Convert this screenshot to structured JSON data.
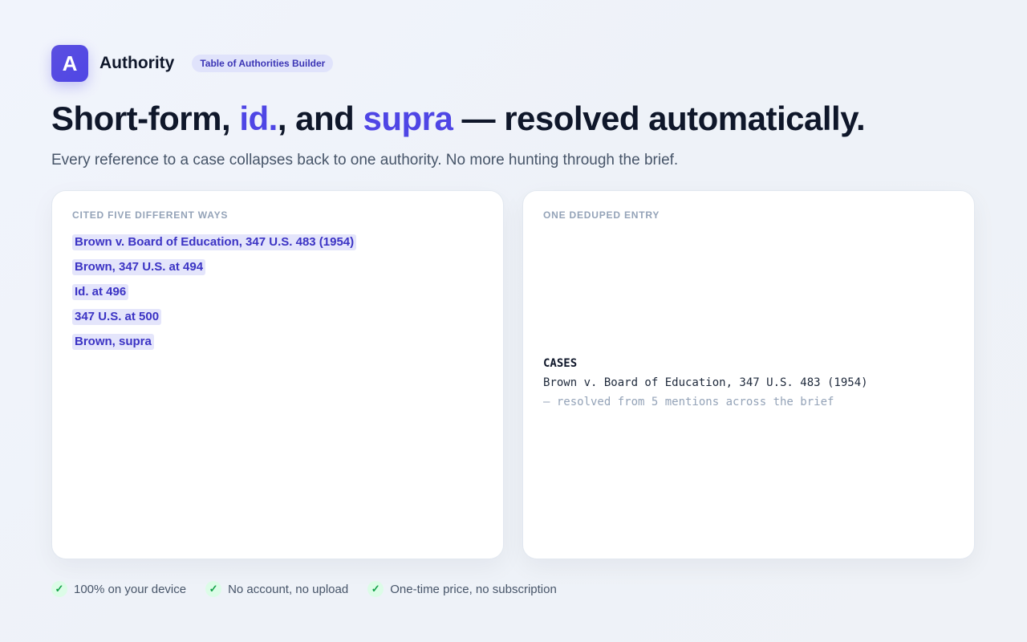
{
  "header": {
    "logo_letter": "A",
    "brand": "Authority",
    "badge": "Table of Authorities Builder"
  },
  "headline": {
    "part1": "Short-form, ",
    "accent1": "id.",
    "part2": ", and ",
    "accent2": "supra",
    "part3": " — resolved automatically."
  },
  "subhead": "Every reference to a case collapses back to one authority. No more hunting through the brief.",
  "left_card": {
    "label": "CITED FIVE DIFFERENT WAYS",
    "citations": [
      "Brown v. Board of Education, 347 U.S. 483 (1954)",
      "Brown, 347 U.S. at 494",
      "Id. at 496",
      "347 U.S. at 500",
      "Brown, supra"
    ]
  },
  "right_card": {
    "label": "ONE DEDUPED ENTRY",
    "section": "CASES",
    "entry": "Brown v. Board of Education, 347 U.S. 483 (1954)",
    "note": "— resolved from 5 mentions across the brief"
  },
  "features": [
    "100% on your device",
    "No account, no upload",
    "One-time price, no subscription"
  ],
  "colors": {
    "accent": "#4f46e5",
    "check": "#16a34a"
  },
  "icons": {
    "feature_icon": "check-icon"
  }
}
